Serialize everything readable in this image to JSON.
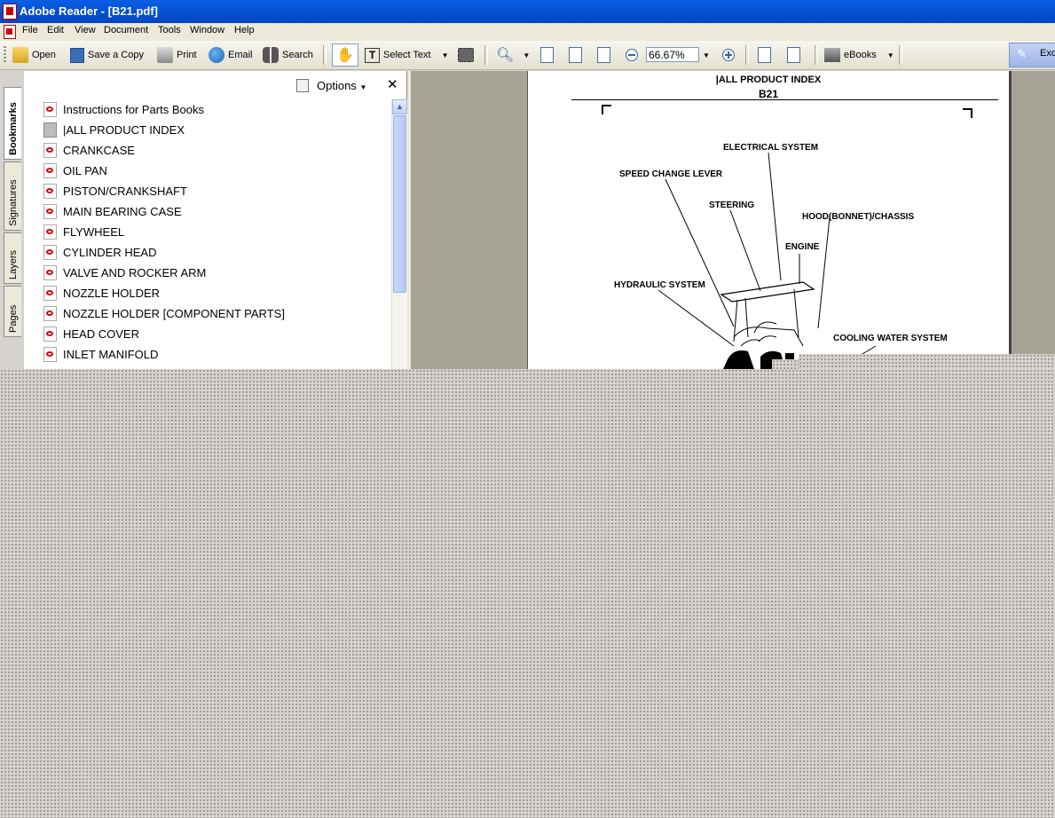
{
  "window": {
    "title": "Adobe Reader - [B21.pdf]"
  },
  "menu": [
    "File",
    "Edit",
    "View",
    "Document",
    "Tools",
    "Window",
    "Help"
  ],
  "toolbar": {
    "open": "Open",
    "save_copy": "Save a Copy",
    "print": "Print",
    "email": "Email",
    "search": "Search",
    "select_text": "Select Text",
    "zoom": "66.67%",
    "ebooks": "eBooks",
    "right_button": "Exc"
  },
  "nav_tabs": [
    "Bookmarks",
    "Signatures",
    "Layers",
    "Pages"
  ],
  "bookmarks": {
    "options_label": "Options",
    "items": [
      "Instructions for Parts Books",
      "|ALL PRODUCT INDEX",
      "CRANKCASE",
      "OIL PAN",
      "PISTON/CRANKSHAFT",
      "MAIN BEARING CASE",
      "FLYWHEEL",
      "CYLINDER HEAD",
      "VALVE AND ROCKER ARM",
      "NOZZLE HOLDER",
      "NOZZLE HOLDER [COMPONENT PARTS]",
      "HEAD COVER",
      "INLET MANIFOLD"
    ]
  },
  "document": {
    "header": "|ALL PRODUCT INDEX",
    "model": "B21",
    "labels": {
      "electrical": "ELECTRICAL SYSTEM",
      "speed_change": "SPEED CHANGE LEVER",
      "steering": "STEERING",
      "hood": "HOOD(BONNET)/CHASSIS",
      "engine": "ENGINE",
      "hydraulic": "HYDRAULIC SYSTEM",
      "cooling": "COOLING WATER SYSTEM"
    }
  }
}
